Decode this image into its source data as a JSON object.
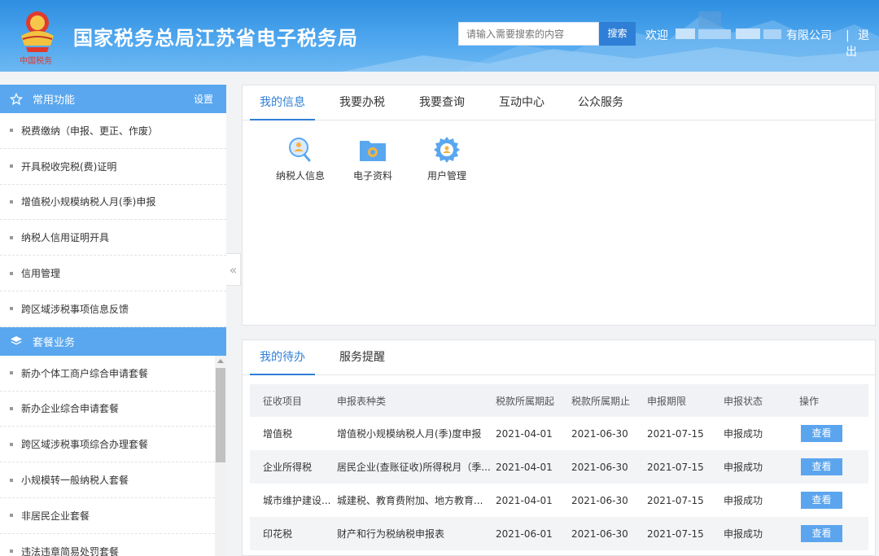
{
  "header": {
    "site_title": "国家税务总局江苏省电子税务局",
    "search_placeholder": "请输入需要搜索的内容",
    "search_label": "搜索",
    "welcome": "欢迎",
    "company_suffix": "有限公司",
    "separator": "|",
    "logout": "退出"
  },
  "sidebar": {
    "common": {
      "title": "常用功能",
      "settings": "设置",
      "items": [
        "税费缴纳（申报、更正、作废）",
        "开具税收完税(费)证明",
        "增值税小规模纳税人月(季)申报",
        "纳税人信用证明开具",
        "信用管理",
        "跨区域涉税事项信息反馈"
      ]
    },
    "packages": {
      "title": "套餐业务",
      "items": [
        "新办个体工商户综合申请套餐",
        "新办企业综合申请套餐",
        "跨区域涉税事项综合办理套餐",
        "小规模转一般纳税人套餐",
        "非居民企业套餐",
        "违法违章简易处罚套餐"
      ]
    }
  },
  "panel1": {
    "tabs": [
      "我的信息",
      "我要办税",
      "我要查询",
      "互动中心",
      "公众服务"
    ],
    "icons": [
      "纳税人信息",
      "电子资料",
      "用户管理"
    ]
  },
  "panel2": {
    "tabs": [
      "我的待办",
      "服务提醒"
    ],
    "columns": [
      "征收项目",
      "申报表种类",
      "税款所属期起",
      "税款所属期止",
      "申报期限",
      "申报状态",
      "操作"
    ],
    "rows": [
      {
        "item": "增值税",
        "form": "增值税小规模纳税人月(季)度申报",
        "start": "2021-04-01",
        "end": "2021-06-30",
        "deadline": "2021-07-15",
        "status": "申报成功",
        "action": "查看"
      },
      {
        "item": "企业所得税",
        "form": "居民企业(查账征收)所得税月（季...",
        "start": "2021-04-01",
        "end": "2021-06-30",
        "deadline": "2021-07-15",
        "status": "申报成功",
        "action": "查看"
      },
      {
        "item": "城市维护建设...",
        "form": "城建税、教育费附加、地方教育...",
        "start": "2021-04-01",
        "end": "2021-06-30",
        "deadline": "2021-07-15",
        "status": "申报成功",
        "action": "查看"
      },
      {
        "item": "印花税",
        "form": "财产和行为税纳税申报表",
        "start": "2021-06-01",
        "end": "2021-06-30",
        "deadline": "2021-07-15",
        "status": "申报成功",
        "action": "查看"
      }
    ]
  },
  "colors": {
    "header_blue": "#3d9be9",
    "accent_blue": "#2f7fd6",
    "sidebar_header": "#5aa7ef",
    "view_button": "#5ba5ee"
  }
}
